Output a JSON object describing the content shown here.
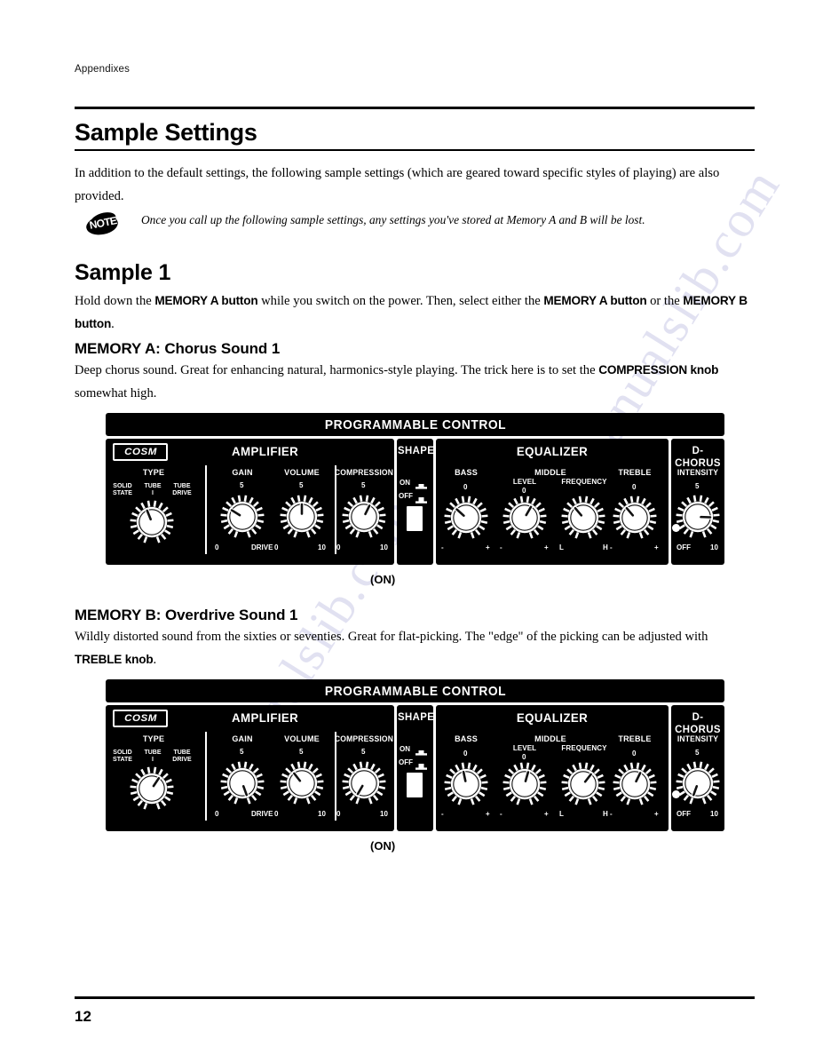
{
  "document": {
    "running_head": "Appendixes",
    "page_number": "12",
    "watermark": "manualslib.com"
  },
  "title": "Sample Settings",
  "intro": {
    "paragraph": "In addition to the default settings, the following sample settings (which are geared toward specific styles of playing) are also provided.",
    "note_badge": "NOTE",
    "note_text": "Once you call up the following sample settings, any settings you've stored at Memory A and B will be lost."
  },
  "sample1": {
    "heading": "Sample 1",
    "instructions": {
      "part1": "Hold down the ",
      "bold1": "MEMORY A button",
      "part2": " while you switch on the power. Then, select either the ",
      "bold2": "MEMORY A button",
      "part3": " or the ",
      "bold3": "MEMORY B button",
      "part4": "."
    }
  },
  "memory_a": {
    "heading": "MEMORY A: Chorus Sound 1",
    "description": {
      "part1": "Deep chorus sound. Great for enhancing natural, harmonics-style playing. The trick here is to set the ",
      "bold1": "COMPRESSION knob",
      "part2": " somewhat high."
    }
  },
  "memory_b": {
    "heading": "MEMORY B: Overdrive Sound 1",
    "description": {
      "part1": "Wildly distorted sound from the sixties or seventies. Great for flat-picking. The \"edge\" of the picking can be adjusted with ",
      "bold1": "TREBLE knob",
      "part2": "."
    }
  },
  "panel_labels": {
    "title": "PROGRAMMABLE CONTROL",
    "cosm": "COSM",
    "amplifier": "AMPLIFIER",
    "shape": "SHAPE",
    "equalizer": "EQUALIZER",
    "dchorus": "D-CHORUS",
    "type": "TYPE",
    "gain": "GAIN",
    "volume": "VOLUME",
    "compression": "COMPRESSION",
    "bass": "BASS",
    "middle": "MIDDLE",
    "level": "LEVEL",
    "frequency": "FREQUENCY",
    "treble": "TREBLE",
    "intensity": "INTENSITY",
    "type_positions": [
      "SOLID\nSTATE",
      "TUBE\nI",
      "TUBE\nDRIVE"
    ],
    "shape_on": "ON",
    "shape_off": "OFF",
    "shape_caption": "(ON)",
    "scale_0": "0",
    "scale_5": "5",
    "scale_10": "10",
    "scale_drive": "DRIVE",
    "scale_minus": "-",
    "scale_plus": "+",
    "scale_L": "L",
    "scale_H": "H",
    "scale_off": "OFF"
  },
  "panel_a": {
    "caption": "MEMORY A: Chorus Sound 1 panel",
    "shape_switch": "ON",
    "knobs": {
      "type": {
        "label": "TYPE",
        "angle": -22,
        "value": "TUBE I"
      },
      "gain": {
        "label": "GAIN",
        "angle": -58,
        "value": "3"
      },
      "volume": {
        "label": "VOLUME",
        "angle": 0,
        "value": "5"
      },
      "compression": {
        "label": "COMPRESSION",
        "angle": 26,
        "value": "7"
      },
      "bass": {
        "label": "BASS",
        "angle": -48,
        "value": "-2"
      },
      "middle_level": {
        "label": "LEVEL",
        "angle": 30,
        "value": "+2"
      },
      "middle_frequency": {
        "label": "FREQUENCY",
        "angle": -40,
        "value": "L"
      },
      "treble": {
        "label": "TREBLE",
        "angle": -40,
        "value": "-1"
      },
      "intensity": {
        "label": "INTENSITY",
        "angle": 92,
        "value": "8"
      }
    }
  },
  "panel_b": {
    "caption": "MEMORY B: Overdrive Sound 1 panel",
    "shape_switch": "ON",
    "knobs": {
      "type": {
        "label": "TYPE",
        "angle": 34,
        "value": "TUBE DRIVE"
      },
      "gain": {
        "label": "GAIN",
        "angle": 160,
        "value": "10 DRIVE"
      },
      "volume": {
        "label": "VOLUME",
        "angle": -38,
        "value": "3"
      },
      "compression": {
        "label": "COMPRESSION",
        "angle": -150,
        "value": "0"
      },
      "bass": {
        "label": "BASS",
        "angle": -12,
        "value": "0"
      },
      "middle_level": {
        "label": "LEVEL",
        "angle": 16,
        "value": "+1"
      },
      "middle_frequency": {
        "label": "FREQUENCY",
        "angle": 38,
        "value": "H"
      },
      "treble": {
        "label": "TREBLE",
        "angle": 26,
        "value": "+2"
      },
      "intensity": {
        "label": "INTENSITY",
        "angle": -160,
        "value": "OFF"
      }
    }
  }
}
